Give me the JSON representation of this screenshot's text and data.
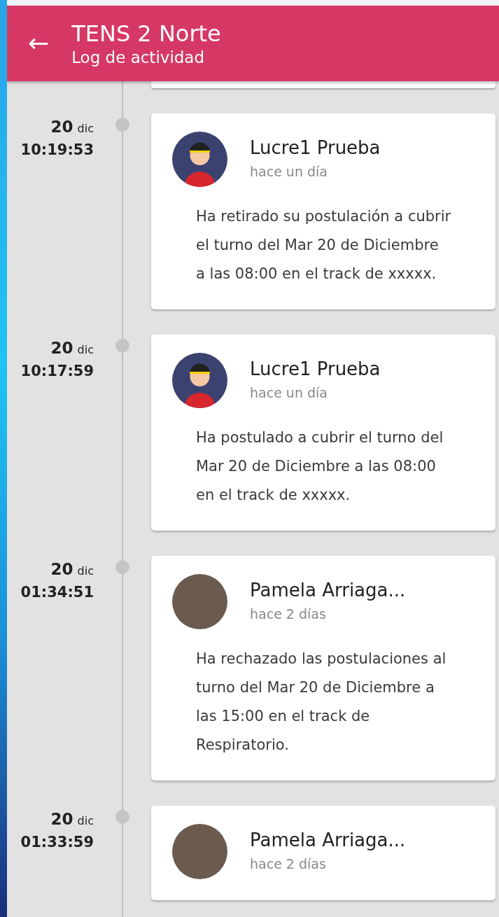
{
  "header": {
    "back_icon": "←",
    "title": "TENS 2 Norte",
    "subtitle": "Log de actividad"
  },
  "entries": [
    {
      "day": "20",
      "month": "dic",
      "time": "10:19:53",
      "kind": "cartoon",
      "name": "Lucre1 Prueba",
      "ago": "hace un día",
      "message": "Ha retirado su postulación a cubrir el turno del Mar 20 de Diciembre a las 08:00 en el track de xxxxx."
    },
    {
      "day": "20",
      "month": "dic",
      "time": "10:17:59",
      "kind": "cartoon",
      "name": "Lucre1 Prueba",
      "ago": "hace un día",
      "message": "Ha postulado a cubrir el turno del Mar 20 de Diciembre a las 08:00 en el track de xxxxx."
    },
    {
      "day": "20",
      "month": "dic",
      "time": "01:34:51",
      "kind": "photo",
      "name": "Pamela Arriaga...",
      "ago": "hace 2 días",
      "message": "Ha rechazado las postulaciones al turno del Mar 20 de Diciembre a las 15:00 en el track de Respiratorio."
    },
    {
      "day": "20",
      "month": "dic",
      "time": "01:33:59",
      "kind": "photo",
      "name": "Pamela Arriaga...",
      "ago": "hace 2 días"
    }
  ]
}
